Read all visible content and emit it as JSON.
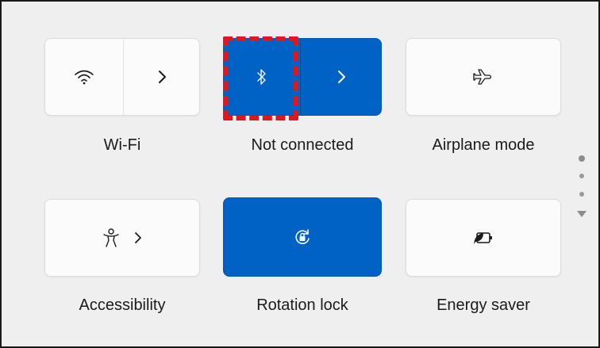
{
  "quick_settings": {
    "tiles": [
      {
        "label": "Wi-Fi",
        "state": "off",
        "icon": "wifi-icon",
        "has_expand": true
      },
      {
        "label": "Not connected",
        "state": "on",
        "icon": "bluetooth-icon",
        "has_expand": true
      },
      {
        "label": "Airplane mode",
        "state": "off",
        "icon": "airplane-icon",
        "has_expand": false
      },
      {
        "label": "Accessibility",
        "state": "off",
        "icon": "accessibility-icon",
        "has_expand": true
      },
      {
        "label": "Rotation lock",
        "state": "on",
        "icon": "rotation-lock-icon",
        "has_expand": false
      },
      {
        "label": "Energy saver",
        "state": "off",
        "icon": "energy-saver-icon",
        "has_expand": false
      }
    ],
    "pager": {
      "current_page": 1,
      "pages": 3
    }
  },
  "colors": {
    "accent": "#0062c4",
    "panel_background": "#efefef",
    "tile_background": "#fbfbfb",
    "highlight_annotation": "#e3161d"
  },
  "annotation": {
    "highlighted_element": "bluetooth-toggle",
    "style": "red dashed box"
  }
}
